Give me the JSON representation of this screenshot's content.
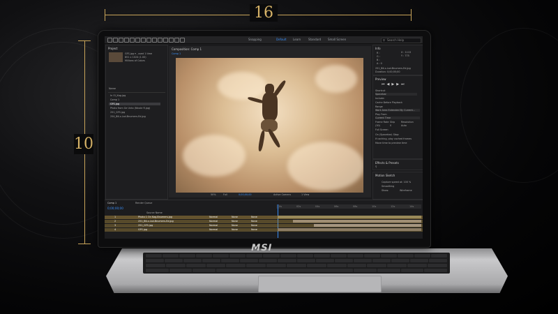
{
  "dimensions": {
    "width_label": "16",
    "height_label": "10"
  },
  "laptop": {
    "brand": "MSI"
  },
  "app": {
    "workspace_tabs": [
      "Default",
      "Learn",
      "Standard",
      "Small Screen"
    ],
    "snapping_label": "Snapping",
    "search_placeholder": "Search Help",
    "project": {
      "title": "Project",
      "file_info": [
        "GFS.jpg ▾ , used 1 time",
        "851 x 1024 (1.00)",
        "Millions of Colors"
      ],
      "column_name": "Name",
      "items": [
        "In Ol_Kag.jpg",
        "Comp 1",
        "GFS.jpg",
        "Photo from Ge Unto (Nicole R.jpg)",
        "251_GFS.jpg",
        "254_BK-x-Lsd-Bnumers-Ed.jpg"
      ],
      "selected_index": 2
    },
    "composition": {
      "tab_label": "Composition: Comp 1",
      "sub_tab": "Comp 1",
      "footer": [
        "50%",
        "Full",
        "0;00;00;00",
        "Active Camera",
        "1 View"
      ]
    },
    "info_panel": {
      "title": "Info",
      "values": [
        "X : 1115",
        "Y : 775",
        "R :",
        "G :",
        "B :",
        "A : 0"
      ],
      "file_lines": [
        "251_BK-x-Lsd-Bnumers-Ed.jpg",
        "Duration: 0;00;05;00"
      ]
    },
    "preview": {
      "title": "Preview",
      "shortcut_label": "Shortcut",
      "shortcut_value": "Spacebar",
      "include_label": "Include:",
      "options": [
        "Cache Before Playback",
        "Range",
        "Work Area Extended By Current...",
        "Play From",
        "Current Time",
        "Frame Rate",
        "Skip",
        "Resolution",
        "(30)",
        "0",
        "Auto",
        "Full Screen",
        "On (Spacebar) Stop:",
        "If caching, play cached frames",
        "Move time to preview time"
      ]
    },
    "effects": {
      "title": "Effects & Presets",
      "search_icon": "search-icon"
    },
    "motion_sketch": {
      "title": "Motion Sketch",
      "lines": [
        "Capture speed at: 100 %",
        "Smoothing",
        "Show:",
        "Wireframe"
      ]
    },
    "timeline": {
      "tab_label": "Comp 1",
      "render_queue": "Render Queue",
      "timecode": "0;00;00;00",
      "layer_header": "Source Name",
      "layers": [
        {
          "num": "1",
          "name": "Photo 1 On Kag-Bnumers.jpg",
          "mode": "Normal",
          "trkmat": "None",
          "parent": "None"
        },
        {
          "num": "2",
          "name": "251_BK-x-Lsd-Bnumers-Ed.jpg",
          "mode": "Normal",
          "trkmat": "None",
          "parent": "None"
        },
        {
          "num": "3",
          "name": "251_GFS.jpg",
          "mode": "Normal",
          "trkmat": "None",
          "parent": "None"
        },
        {
          "num": "4",
          "name": "GFS.jpg",
          "mode": "Normal",
          "trkmat": "None",
          "parent": "None"
        }
      ],
      "ruler": [
        "0s",
        "02s",
        "04s",
        "06s",
        "08s",
        "10s",
        "12s",
        "14s"
      ]
    }
  },
  "colors": {
    "accent": "#c9a55a",
    "ui_blue": "#3a8ef6",
    "sepia_light": "#f3dfc2",
    "sepia_dark": "#8a6a4a"
  }
}
